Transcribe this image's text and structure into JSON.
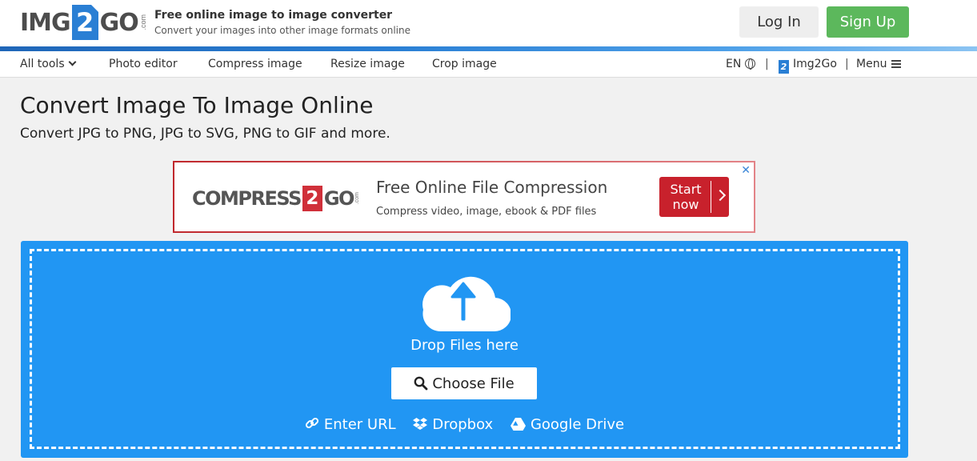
{
  "header": {
    "logo_left": "IMG",
    "logo_mid": "2",
    "logo_right": "GO",
    "logo_com": ".com",
    "tagline_title": "Free online image to image converter",
    "tagline_sub": "Convert your images into other image formats online",
    "login_label": "Log In",
    "signup_label": "Sign Up"
  },
  "nav": {
    "all_tools": "All tools",
    "photo_editor": "Photo editor",
    "compress": "Compress image",
    "resize": "Resize image",
    "crop": "Crop image",
    "lang": "EN",
    "sep": "|",
    "brand": "Img2Go",
    "brand_icon": "2",
    "menu": "Menu"
  },
  "main": {
    "title": "Convert Image To Image Online",
    "subtitle": "Convert JPG to PNG, JPG to SVG, PNG to GIF and more."
  },
  "ad": {
    "close": "✕",
    "logo_left": "COMPRESS",
    "logo_mid": "2",
    "logo_right": "GO",
    "logo_com": ".com",
    "title": "Free Online File Compression",
    "description": "Compress video, image, ebook & PDF files",
    "cta_line1": "Start",
    "cta_line2": "now"
  },
  "upload": {
    "drop_text": "Drop Files here",
    "choose_label": "Choose File",
    "url_label": "Enter URL",
    "dropbox_label": "Dropbox",
    "gdrive_label": "Google Drive"
  },
  "colors": {
    "brand_blue": "#2a7fd4",
    "upload_blue": "#2196f3",
    "signup_green": "#5cb85c",
    "ad_red": "#c8212c"
  },
  "icons": {
    "upload": "cloud-upload-icon",
    "search": "search-icon",
    "link": "link-icon",
    "dropbox": "dropbox-icon",
    "gdrive": "google-drive-icon",
    "globe": "globe-icon",
    "menu": "hamburger-icon"
  }
}
